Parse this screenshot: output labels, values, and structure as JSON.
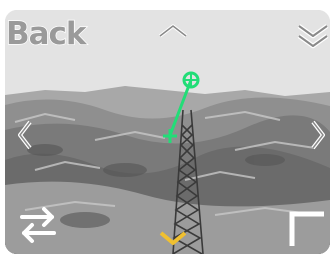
{
  "navigation": {
    "back_label": "Back"
  },
  "icons": {
    "up": "chevron-up-icon",
    "down": "chevron-down-icon",
    "left": "chevron-left-icon",
    "right": "chevron-right-icon",
    "dropdown": "double-chevron-down-icon",
    "swap": "swap-arrows-icon",
    "corner": "corner-bracket-icon"
  },
  "colors": {
    "target_line": "#22dd77",
    "down_chevron": "#f0c030",
    "overlay_icon": "#ffffff"
  }
}
